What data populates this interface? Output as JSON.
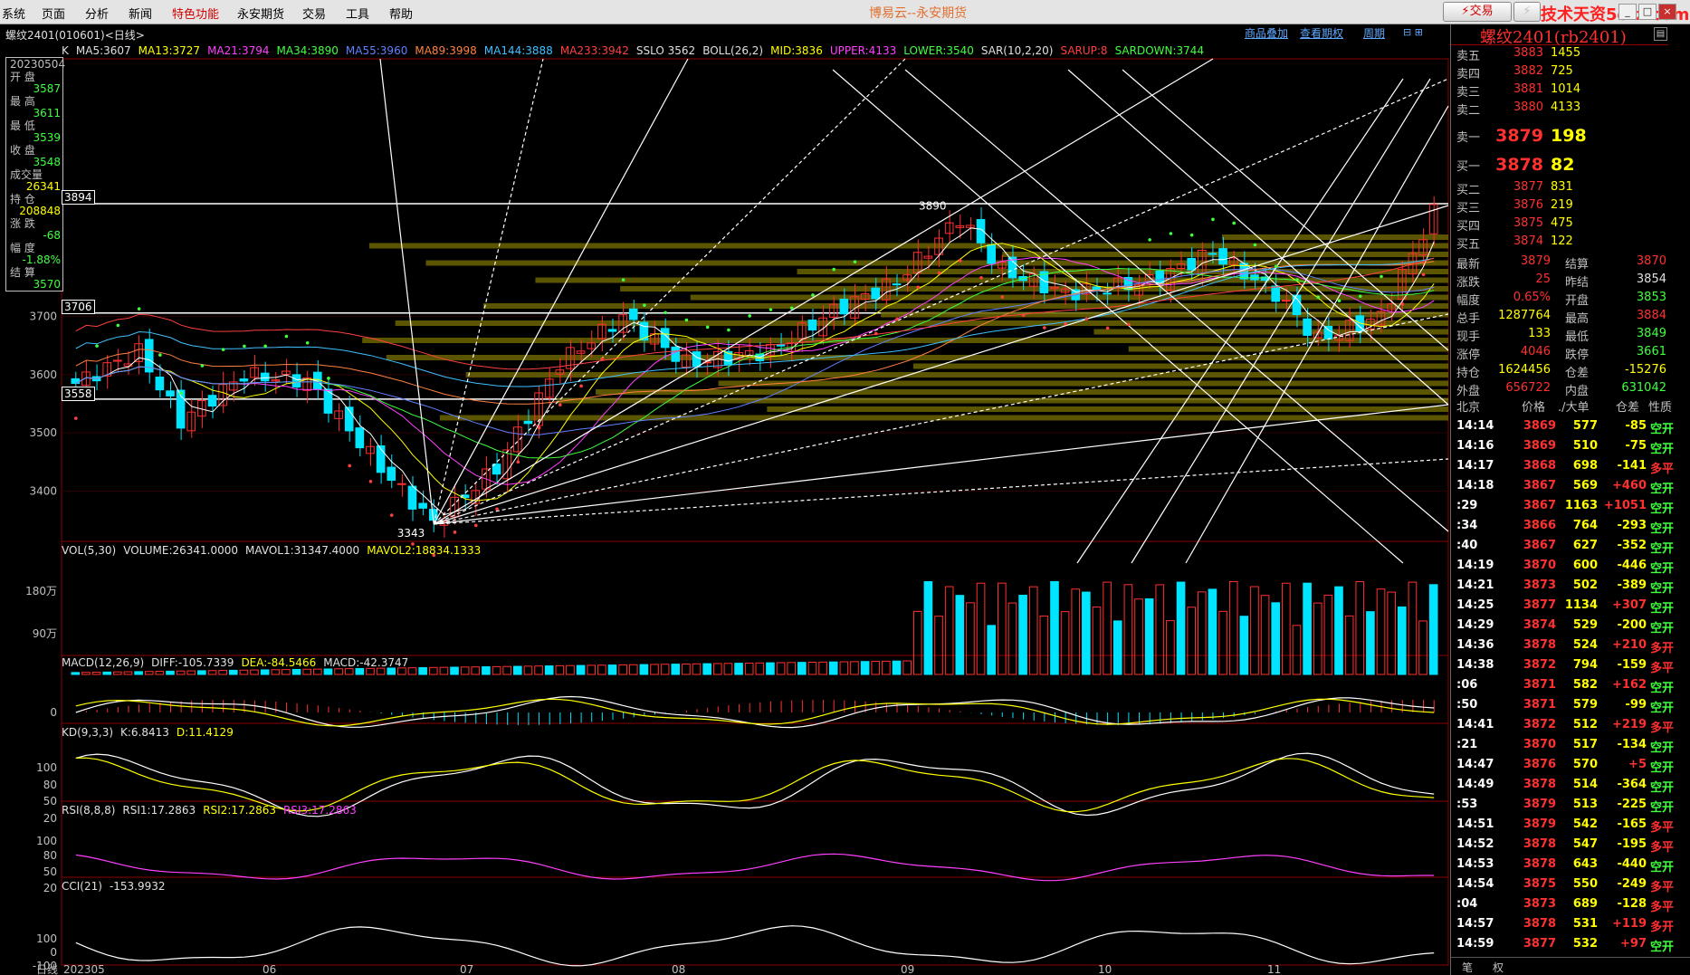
{
  "menu": [
    "系统",
    "页面",
    "分析",
    "新闻",
    "特色功能",
    "永安期货",
    "交易",
    "工具",
    "帮助"
  ],
  "menu_hot_index": 4,
  "app_title": "博易云--永安期货",
  "trade_button": "交易",
  "watermark": "技术天资5etz.com",
  "chart": {
    "symbol_title": "螺纹2401(010601)<日线>",
    "links": [
      "商品叠加",
      "查看期权",
      "周期"
    ],
    "ma_indicators": [
      {
        "text": "K",
        "color": "#e0e0e0"
      },
      {
        "text": "MA5:3607",
        "color": "#e0e0e0"
      },
      {
        "text": "MA13:3727",
        "color": "#ffff00"
      },
      {
        "text": "MA21:3794",
        "color": "#ff40ff"
      },
      {
        "text": "MA34:3890",
        "color": "#40ff40"
      },
      {
        "text": "MA55:3960",
        "color": "#6080ff"
      },
      {
        "text": "MA89:3998",
        "color": "#ff8040"
      },
      {
        "text": "MA144:3888",
        "color": "#40c0ff"
      },
      {
        "text": "MA233:3942",
        "color": "#ff4040"
      },
      {
        "text": "SSLO 3562",
        "color": "#e0e0e0"
      },
      {
        "text": "BOLL(26,2)",
        "color": "#e0e0e0"
      },
      {
        "text": "MID:3836",
        "color": "#ffff00"
      },
      {
        "text": "UPPER:4133",
        "color": "#ff40ff"
      },
      {
        "text": "LOWER:3540",
        "color": "#40ff40"
      },
      {
        "text": "SAR(10,2,20)",
        "color": "#e0e0e0"
      },
      {
        "text": "SARUP:8",
        "color": "#ff4040"
      },
      {
        "text": "SARDOWN:3744",
        "color": "#40ff40"
      }
    ],
    "info_box": [
      {
        "label": "20230504",
        "value": ""
      },
      {
        "label": "开 盘",
        "value": "3587",
        "color": "#40ff40"
      },
      {
        "label": "最 高",
        "value": "3611",
        "color": "#40ff40"
      },
      {
        "label": "最 低",
        "value": "3539",
        "color": "#40ff40"
      },
      {
        "label": "收 盘",
        "value": "3548",
        "color": "#40ff40"
      },
      {
        "label": "成交量",
        "value": "26341",
        "color": "#ffff00"
      },
      {
        "label": "持 仓",
        "value": "208848",
        "color": "#ffff00"
      },
      {
        "label": "涨 跌",
        "value": "-68",
        "color": "#40ff40"
      },
      {
        "label": "幅 度",
        "value": "-1.88%",
        "color": "#40ff40"
      },
      {
        "label": "结 算",
        "value": "3570",
        "color": "#40ff40"
      }
    ],
    "price_tags": [
      "3894",
      "3706",
      "3558"
    ],
    "price_axis": [
      "3700",
      "3600",
      "3500",
      "3400"
    ],
    "annotations": {
      "high": "3890",
      "low": "3343"
    },
    "vol_line": [
      {
        "text": "VOL(5,30)",
        "color": "#e0e0e0"
      },
      {
        "text": "VOLUME:26341.0000",
        "color": "#e0e0e0"
      },
      {
        "text": "MAVOL1:31347.4000",
        "color": "#e0e0e0"
      },
      {
        "text": "MAVOL2:18834.1333",
        "color": "#ffff00"
      }
    ],
    "vol_axis": [
      "180万",
      "90万"
    ],
    "macd_line": [
      {
        "text": "MACD(12,26,9)",
        "color": "#e0e0e0"
      },
      {
        "text": "DIFF:-105.7339",
        "color": "#e0e0e0"
      },
      {
        "text": "DEA:-84.5466",
        "color": "#ffff00"
      },
      {
        "text": "MACD:-42.3747",
        "color": "#e0e0e0"
      }
    ],
    "macd_axis": [
      "0"
    ],
    "kd_line": [
      {
        "text": "KD(9,3,3)",
        "color": "#e0e0e0"
      },
      {
        "text": "K:6.8413",
        "color": "#e0e0e0"
      },
      {
        "text": "D:11.4129",
        "color": "#ffff00"
      }
    ],
    "kd_axis": [
      "100",
      "80",
      "50",
      "20"
    ],
    "rsi_line": [
      {
        "text": "RSI(8,8,8)",
        "color": "#e0e0e0"
      },
      {
        "text": "RSI1:17.2863",
        "color": "#e0e0e0"
      },
      {
        "text": "RSI2:17.2863",
        "color": "#ffff00"
      },
      {
        "text": "RSI3:17.2863",
        "color": "#ff40ff"
      }
    ],
    "rsi_axis": [
      "100",
      "80",
      "50",
      "20"
    ],
    "cci_line": [
      {
        "text": "CCI(21)",
        "color": "#e0e0e0"
      },
      {
        "text": "-153.9932",
        "color": "#e0e0e0"
      }
    ],
    "cci_axis": [
      "100",
      "0",
      "-100"
    ],
    "time_axis": {
      "left_label": "日线",
      "labels": [
        "202305",
        "06",
        "07",
        "08",
        "09",
        "10",
        "11"
      ]
    }
  },
  "quote": {
    "title": "螺纹2401(rb2401)",
    "asks": [
      {
        "label": "卖五",
        "price": "3883",
        "vol": "1455"
      },
      {
        "label": "卖四",
        "price": "3882",
        "vol": "725"
      },
      {
        "label": "卖三",
        "price": "3881",
        "vol": "1014"
      },
      {
        "label": "卖二",
        "price": "3880",
        "vol": "4133"
      },
      {
        "label": "卖一",
        "price": "3879",
        "vol": "198"
      }
    ],
    "bids": [
      {
        "label": "买一",
        "price": "3878",
        "vol": "82"
      },
      {
        "label": "买二",
        "price": "3877",
        "vol": "831"
      },
      {
        "label": "买三",
        "price": "3876",
        "vol": "219"
      },
      {
        "label": "买四",
        "price": "3875",
        "vol": "475"
      },
      {
        "label": "买五",
        "price": "3874",
        "vol": "122"
      }
    ],
    "stats": [
      {
        "l1": "最新",
        "v1": "3879",
        "c1": "#ff3030",
        "l2": "结算",
        "v2": "3870",
        "c2": "#ff3030"
      },
      {
        "l1": "涨跌",
        "v1": "25",
        "c1": "#ff3030",
        "l2": "昨结",
        "v2": "3854",
        "c2": "#e0e0e0"
      },
      {
        "l1": "幅度",
        "v1": "0.65%",
        "c1": "#ff3030",
        "l2": "开盘",
        "v2": "3853",
        "c2": "#40ff40"
      },
      {
        "l1": "总手",
        "v1": "1287764",
        "c1": "#ffff00",
        "l2": "最高",
        "v2": "3884",
        "c2": "#ff3030"
      },
      {
        "l1": "现手",
        "v1": "133",
        "c1": "#ffff00",
        "l2": "最低",
        "v2": "3849",
        "c2": "#40ff40"
      },
      {
        "l1": "涨停",
        "v1": "4046",
        "c1": "#ff3030",
        "l2": "跌停",
        "v2": "3661",
        "c2": "#40ff40"
      },
      {
        "l1": "持仓",
        "v1": "1624456",
        "c1": "#ffff00",
        "l2": "仓差",
        "v2": "-15276",
        "c2": "#ffff00"
      },
      {
        "l1": "外盘",
        "v1": "656722",
        "c1": "#ff3030",
        "l2": "内盘",
        "v2": "631042",
        "c2": "#40ff40"
      }
    ],
    "tick_header": [
      "北京",
      "价格",
      "./大单",
      "仓差",
      "性质"
    ],
    "ticks": [
      {
        "time": "14:14",
        "price": "3869",
        "vol": "577",
        "oi": "-85",
        "nature": "空开"
      },
      {
        "time": "14:16",
        "price": "3869",
        "vol": "510",
        "oi": "-75",
        "nature": "空开"
      },
      {
        "time": "14:17",
        "price": "3868",
        "vol": "698",
        "oi": "-141",
        "nature": "多平"
      },
      {
        "time": "14:18",
        "price": "3867",
        "vol": "569",
        "oi": "+460",
        "nature": "空开"
      },
      {
        "time": ":29",
        "price": "3867",
        "vol": "1163",
        "oi": "+1051",
        "nature": "空开"
      },
      {
        "time": ":34",
        "price": "3866",
        "vol": "764",
        "oi": "-293",
        "nature": "空开"
      },
      {
        "time": ":40",
        "price": "3867",
        "vol": "627",
        "oi": "-352",
        "nature": "空开"
      },
      {
        "time": "14:19",
        "price": "3870",
        "vol": "600",
        "oi": "-446",
        "nature": "空开"
      },
      {
        "time": "14:21",
        "price": "3873",
        "vol": "502",
        "oi": "-389",
        "nature": "空开"
      },
      {
        "time": "14:25",
        "price": "3877",
        "vol": "1134",
        "oi": "+307",
        "nature": "空开"
      },
      {
        "time": "14:29",
        "price": "3874",
        "vol": "529",
        "oi": "-200",
        "nature": "空开"
      },
      {
        "time": "14:36",
        "price": "3878",
        "vol": "524",
        "oi": "+210",
        "nature": "多开"
      },
      {
        "time": "14:38",
        "price": "3872",
        "vol": "794",
        "oi": "-159",
        "nature": "多平"
      },
      {
        "time": ":06",
        "price": "3871",
        "vol": "582",
        "oi": "+162",
        "nature": "空开"
      },
      {
        "time": ":50",
        "price": "3871",
        "vol": "579",
        "oi": "-99",
        "nature": "空开"
      },
      {
        "time": "14:41",
        "price": "3872",
        "vol": "512",
        "oi": "+219",
        "nature": "多平"
      },
      {
        "time": ":21",
        "price": "3870",
        "vol": "517",
        "oi": "-134",
        "nature": "空开"
      },
      {
        "time": "14:47",
        "price": "3876",
        "vol": "570",
        "oi": "+5",
        "nature": "空开"
      },
      {
        "time": "14:49",
        "price": "3878",
        "vol": "514",
        "oi": "-364",
        "nature": "空开"
      },
      {
        "time": ":53",
        "price": "3879",
        "vol": "513",
        "oi": "-225",
        "nature": "空开"
      },
      {
        "time": "14:51",
        "price": "3879",
        "vol": "542",
        "oi": "-165",
        "nature": "多平"
      },
      {
        "time": "14:52",
        "price": "3878",
        "vol": "547",
        "oi": "-195",
        "nature": "多平"
      },
      {
        "time": "14:53",
        "price": "3878",
        "vol": "643",
        "oi": "-440",
        "nature": "空开"
      },
      {
        "time": "14:54",
        "price": "3875",
        "vol": "550",
        "oi": "-249",
        "nature": "多平"
      },
      {
        "time": ":04",
        "price": "3873",
        "vol": "689",
        "oi": "-128",
        "nature": "多平"
      },
      {
        "time": "14:57",
        "price": "3878",
        "vol": "531",
        "oi": "+119",
        "nature": "多开"
      },
      {
        "time": "14:59",
        "price": "3877",
        "vol": "532",
        "oi": "+97",
        "nature": "空开"
      }
    ],
    "tabs": [
      "笔",
      "权"
    ]
  },
  "colors": {
    "up": "#ff3030",
    "down": "#00e5ff",
    "menu_bg": "#e4e4e4"
  }
}
